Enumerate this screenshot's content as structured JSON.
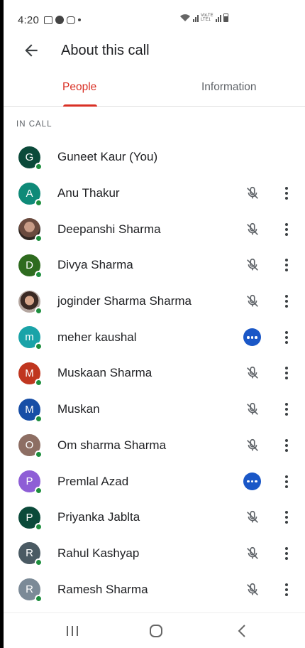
{
  "status_bar": {
    "time": "4:20",
    "network_label": "VoLTE LTE1",
    "icons": [
      "gallery-icon",
      "account-icon",
      "cast-icon",
      "wifi-icon",
      "signal-icon",
      "battery-icon"
    ]
  },
  "app_bar": {
    "title": "About this call",
    "back_icon": "arrow-back-icon"
  },
  "tabs": [
    {
      "label": "People",
      "active": true
    },
    {
      "label": "Information",
      "active": false
    }
  ],
  "section_label": "IN CALL",
  "colors": {
    "accent": "#d93025",
    "presence": "#1e8e3e",
    "speaking": "#1a57c7"
  },
  "participants": [
    {
      "initial": "G",
      "name": "Guneet Kaur (You)",
      "avatar_color": "#0b4a3a",
      "status": "self"
    },
    {
      "initial": "A",
      "name": "Anu Thakur",
      "avatar_color": "#0f8a78",
      "status": "muted"
    },
    {
      "initial": "",
      "name": "Deepanshi Sharma",
      "avatar_color": "photo1",
      "status": "muted"
    },
    {
      "initial": "D",
      "name": "Divya Sharma",
      "avatar_color": "#2e6b1f",
      "status": "muted"
    },
    {
      "initial": "",
      "name": "joginder Sharma Sharma",
      "avatar_color": "photo2",
      "status": "muted"
    },
    {
      "initial": "m",
      "name": "meher kaushal",
      "avatar_color": "#1aa3a8",
      "status": "speaking"
    },
    {
      "initial": "M",
      "name": "Muskaan Sharma",
      "avatar_color": "#c0361f",
      "status": "muted"
    },
    {
      "initial": "M",
      "name": "Muskan",
      "avatar_color": "#174ea6",
      "status": "muted"
    },
    {
      "initial": "O",
      "name": "Om sharma Sharma",
      "avatar_color": "#8d6e63",
      "status": "muted"
    },
    {
      "initial": "P",
      "name": "Premlal Azad",
      "avatar_color": "#8e5ed6",
      "status": "speaking"
    },
    {
      "initial": "P",
      "name": "Priyanka Jablta",
      "avatar_color": "#0b4a3a",
      "status": "muted"
    },
    {
      "initial": "R",
      "name": "Rahul Kashyap",
      "avatar_color": "#4a5a63",
      "status": "muted"
    },
    {
      "initial": "R",
      "name": "Ramesh Sharma",
      "avatar_color": "#7b8a97",
      "status": "muted"
    }
  ],
  "nav_bar": [
    "recent-apps-icon",
    "home-icon",
    "back-icon"
  ]
}
